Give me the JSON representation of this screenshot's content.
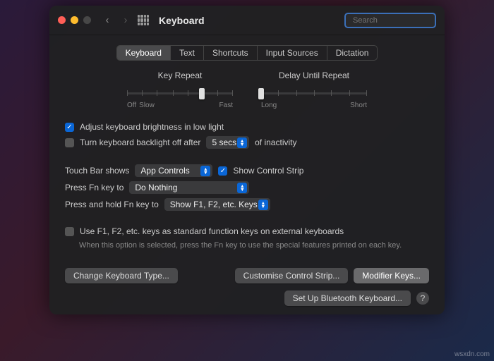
{
  "window": {
    "title": "Keyboard"
  },
  "search": {
    "placeholder": "Search"
  },
  "tabs": [
    "Keyboard",
    "Text",
    "Shortcuts",
    "Input Sources",
    "Dictation"
  ],
  "active_tab": 0,
  "sliders": {
    "key_repeat": {
      "label": "Key Repeat",
      "min": "Off",
      "mid": "Slow",
      "max": "Fast"
    },
    "delay": {
      "label": "Delay Until Repeat",
      "min": "Long",
      "max": "Short"
    }
  },
  "opts": {
    "adjust_brightness": "Adjust keyboard brightness in low light",
    "backlight_off": "Turn keyboard backlight off after",
    "backlight_value": "5 secs",
    "inactivity": "of inactivity",
    "touchbar_label": "Touch Bar shows",
    "touchbar_value": "App Controls",
    "show_strip": "Show Control Strip",
    "fn_label": "Press Fn key to",
    "fn_value": "Do Nothing",
    "fn_hold_label": "Press and hold Fn key to",
    "fn_hold_value": "Show F1, F2, etc. Keys",
    "std_fn": "Use F1, F2, etc. keys as standard function keys on external keyboards",
    "std_fn_hint": "When this option is selected, press the Fn key to use the special features printed on each key."
  },
  "buttons": {
    "change_type": "Change Keyboard Type...",
    "customise": "Customise Control Strip...",
    "modifier": "Modifier Keys...",
    "bluetooth": "Set Up Bluetooth Keyboard...",
    "help": "?"
  },
  "watermark": "wsxdn.com"
}
